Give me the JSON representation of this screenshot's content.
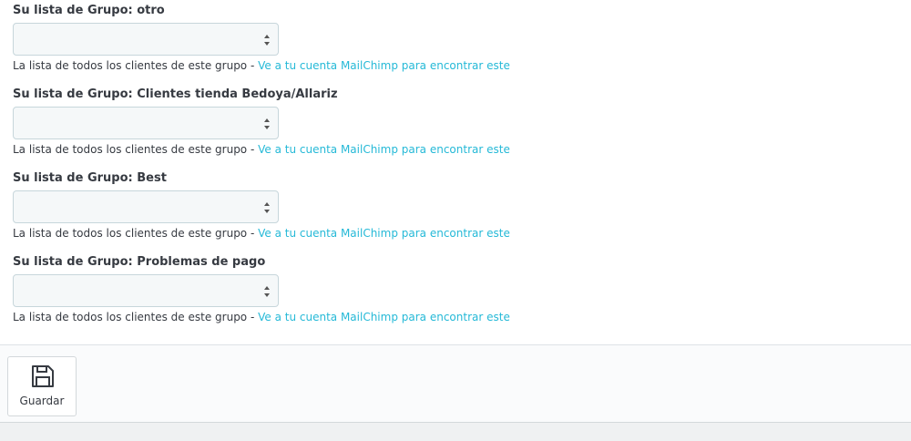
{
  "groups": [
    {
      "label": "Su lista de Grupo: otro",
      "selected": "",
      "help_text": "La lista de todos los clientes de este grupo - ",
      "help_link": "Ve a tu cuenta MailChimp para encontrar este"
    },
    {
      "label": "Su lista de Grupo: Clientes tienda Bedoya/Allariz",
      "selected": "",
      "help_text": "La lista de todos los clientes de este grupo - ",
      "help_link": "Ve a tu cuenta MailChimp para encontrar este"
    },
    {
      "label": "Su lista de Grupo: Best",
      "selected": "",
      "help_text": "La lista de todos los clientes de este grupo - ",
      "help_link": "Ve a tu cuenta MailChimp para encontrar este"
    },
    {
      "label": "Su lista de Grupo: Problemas de pago",
      "selected": "",
      "help_text": "La lista de todos los clientes de este grupo - ",
      "help_link": "Ve a tu cuenta MailChimp para encontrar este"
    }
  ],
  "footer": {
    "save_label": "Guardar",
    "save_icon": "floppy-disk-icon"
  },
  "colors": {
    "link": "#25b9d7",
    "text": "#363a41",
    "select_bg": "#f5f8f9",
    "select_border": "#c7d6db"
  }
}
